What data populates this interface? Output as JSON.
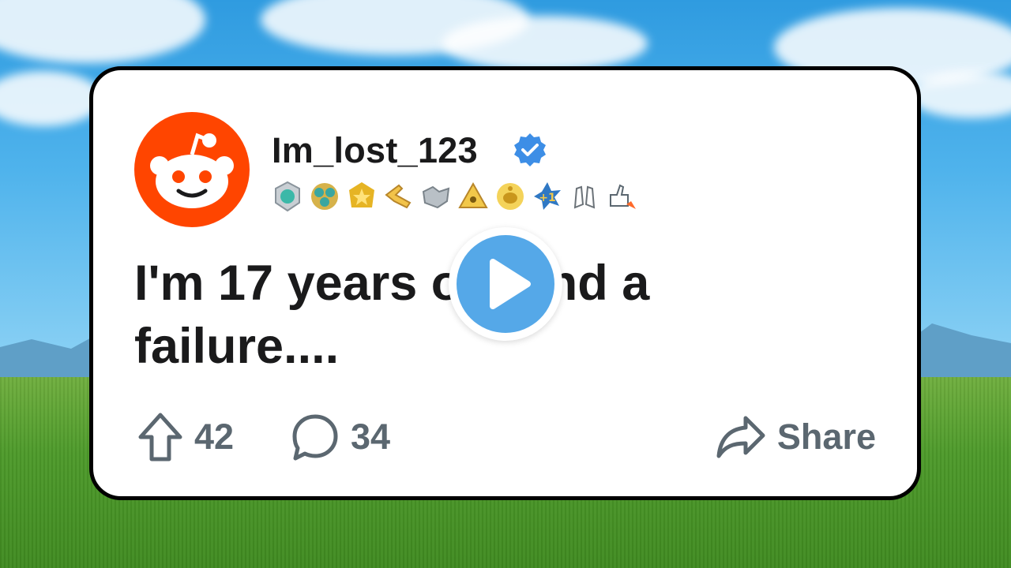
{
  "post": {
    "username": "Im_lost_123",
    "verified": true,
    "title": "I'm 17 years old and a failure....",
    "title_line1": "I'm 17 years old and a",
    "title_line2": "failure....",
    "awards": [
      "helpful-medal-icon",
      "wholesome-flower-icon",
      "gold-star-icon",
      "pointing-hand-icon",
      "handshake-icon",
      "pyramid-icon",
      "gold-snoo-icon",
      "plus-one-icon",
      "clapping-hands-icon",
      "rocket-thumbs-up-icon"
    ]
  },
  "actions": {
    "upvotes": "42",
    "comments": "34",
    "share_label": "Share"
  },
  "colors": {
    "reddit_orange": "#ff4500",
    "verified_blue": "#3d8ee6",
    "play_blue": "#55a8e8",
    "action_gray": "#5b6770"
  }
}
